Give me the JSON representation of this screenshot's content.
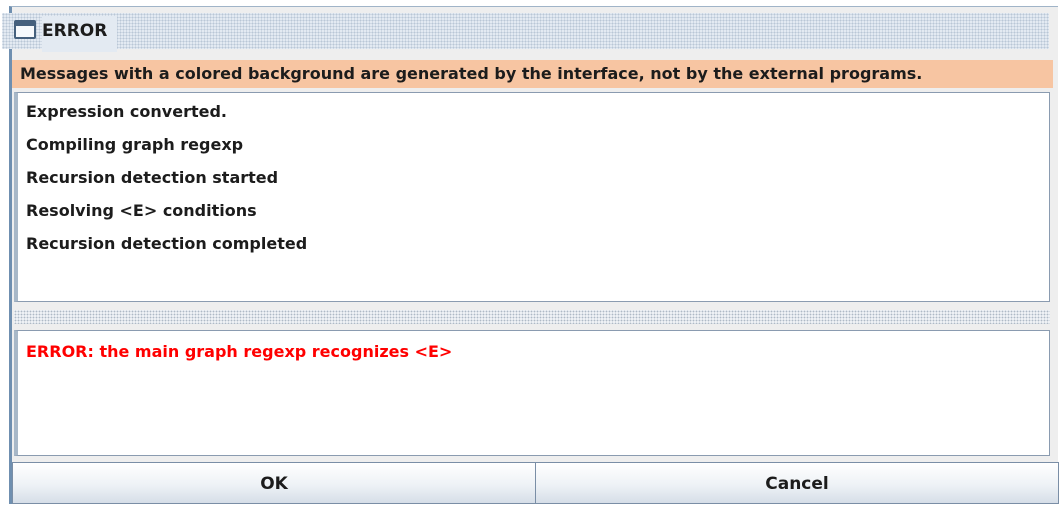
{
  "window": {
    "title": "ERROR",
    "icon": "window-icon"
  },
  "info_bar": {
    "text": "Messages with a colored background are generated by the interface, not by the external programs."
  },
  "log": {
    "lines": [
      "Expression converted.",
      "Compiling graph regexp",
      "Recursion detection started",
      "Resolving <E> conditions",
      "Recursion detection completed"
    ]
  },
  "error": {
    "text": "ERROR: the main graph regexp recognizes <E>",
    "color": "#ff0000"
  },
  "buttons": {
    "ok_label": "OK",
    "cancel_label": "Cancel"
  },
  "colors": {
    "info_background": "#f7c5a2",
    "error_text": "#ff0000"
  }
}
